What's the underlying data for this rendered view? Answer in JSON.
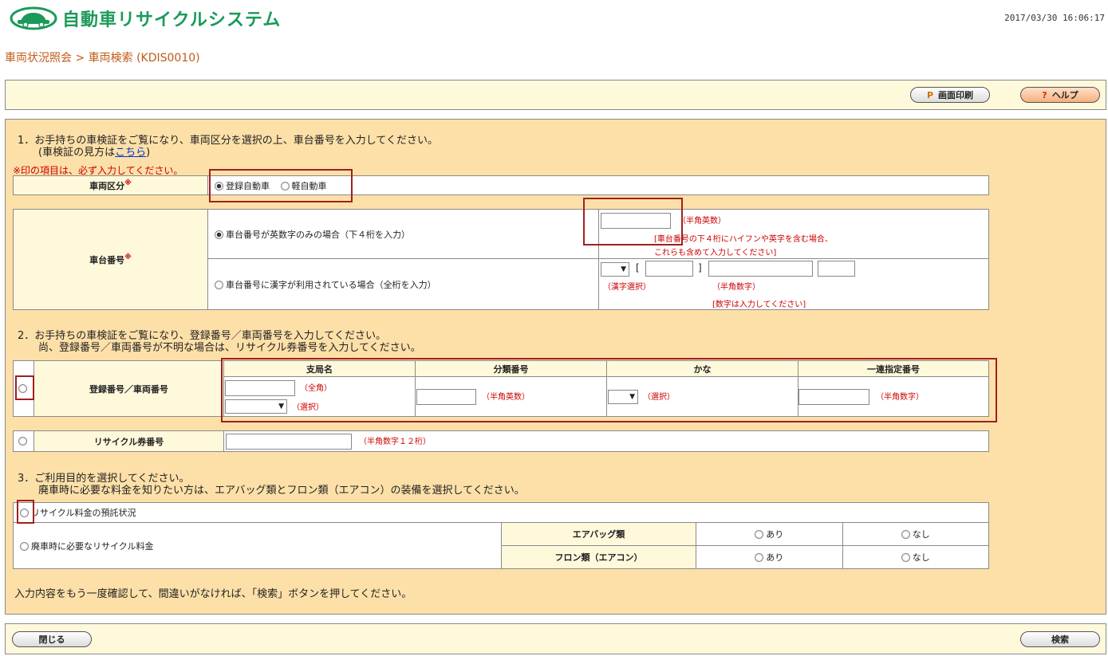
{
  "header": {
    "logo_text": "自動車リサイクルシステム",
    "timestamp": "2017/03/30 16:06:17"
  },
  "breadcrumb": {
    "parent": "車両状況照会",
    "separator": ">",
    "current": "車両検索 (KDIS0010)"
  },
  "toolbar": {
    "print_label": "画面印刷",
    "print_icon": "P",
    "help_label": "ヘルプ",
    "help_icon": "?"
  },
  "section1": {
    "title_line1": "1．お手持ちの車検証をご覧になり、車両区分を選択の上、車台番号を入力してください。",
    "title_line2_prefix": "(車検証の見方は",
    "title_link": "こちら",
    "title_line2_suffix": ")",
    "required_note": "※印の項目は、必ず入力してください。",
    "vehicle_class_label": "車両区分",
    "required_mark": "※",
    "vehicle_class_options": [
      "登録自動車",
      "軽自動車"
    ],
    "vehicle_class_selected": 0,
    "chassis_label": "車台番号",
    "chassis_opt1": "車台番号が英数字のみの場合（下４桁を入力）",
    "chassis_opt1_hint": "（半角英数）",
    "chassis_opt1_note1": "[車台番号の下４桁にハイフンや英字を含む場合、",
    "chassis_opt1_note2": "これらも含めて入力してください]",
    "chassis_opt2": "車台番号に漢字が利用されている場合（全桁を入力）",
    "chassis_opt2_bracket_open": "[",
    "chassis_opt2_bracket_close": "]",
    "chassis_opt2_hint_kanji": "（漢字選択）",
    "chassis_opt2_hint_num": "（半角数字）",
    "chassis_opt2_note": "[数字は入力してください]"
  },
  "section2": {
    "title_line1": "2．お手持ちの車検証をご覧になり、登録番号／車両番号を入力してください。",
    "title_line2": "尚、登録番号／車両番号が不明な場合は、リサイクル券番号を入力してください。",
    "reg_label": "登録番号／車両番号",
    "columns": [
      "支局名",
      "分類番号",
      "かな",
      "一連指定番号"
    ],
    "hint_fullwidth": "（全角）",
    "hint_select": "（選択）",
    "hint_alnum": "（半角英数）",
    "hint_select2": "（選択）",
    "hint_num": "（半角数字）",
    "ticket_label": "リサイクル券番号",
    "ticket_hint": "（半角数字１２桁）"
  },
  "section3": {
    "title_line1": "3．ご利用目的を選択してください。",
    "title_line2": "廃車時に必要な料金を知りたい方は、エアバッグ類とフロン類（エアコン）の装備を選択してください。",
    "purpose1": "リサイクル料金の預託状況",
    "purpose2": "廃車時に必要なリサイクル料金",
    "airbag_label": "エアバッグ類",
    "freon_label": "フロン類（エアコン）",
    "yes": "あり",
    "no": "なし"
  },
  "confirm_text": "入力内容をもう一度確認して、間違いがなければ、「検索」ボタンを押してください。",
  "footer": {
    "close_label": "閉じる",
    "search_label": "検索"
  },
  "colors": {
    "brand_green": "#1a9a5a",
    "breadcrumb": "#c25a18",
    "panel_bg": "#fde0a8",
    "label_bg": "#fff9dc",
    "highlight_box": "#a02020"
  }
}
